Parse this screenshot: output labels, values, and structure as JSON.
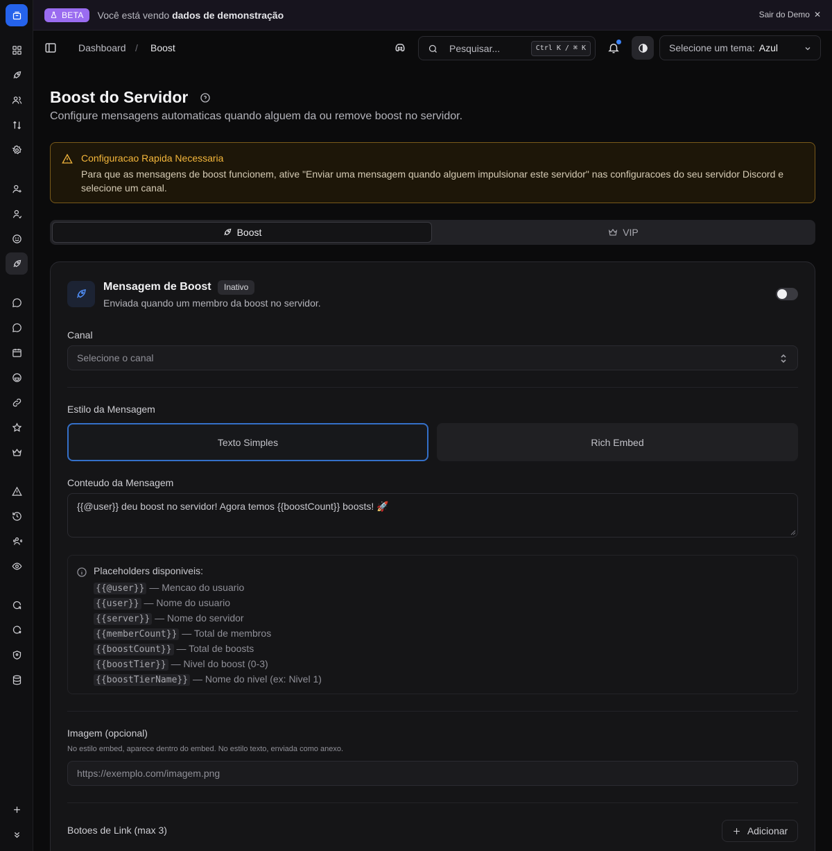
{
  "beta": {
    "badge": "BETA",
    "text_prefix": "Você está vendo ",
    "text_bold": "dados de demonstração",
    "exit": "Sair do Demo"
  },
  "breadcrumb": {
    "root": "Dashboard",
    "separator": "/",
    "current": "Boost"
  },
  "search": {
    "placeholder": "Pesquisar...",
    "shortcut": "Ctrl K / ⌘ K"
  },
  "theme": {
    "label": "Selecione um tema:",
    "value": "Azul"
  },
  "page": {
    "title": "Boost do Servidor",
    "subtitle": "Configure mensagens automaticas quando alguem da ou remove boost no servidor."
  },
  "warning": {
    "title": "Configuracao Rapida Necessaria",
    "body": "Para que as mensagens de boost funcionem, ative \"Enviar uma mensagem quando alguem impulsionar este servidor\" nas configuracoes do seu servidor Discord e selecione um canal."
  },
  "tabs": {
    "boost": "Boost",
    "vip": "VIP"
  },
  "card": {
    "title": "Mensagem de Boost",
    "status": "Inativo",
    "subtitle": "Enviada quando um membro da boost no servidor.",
    "enabled": false
  },
  "channel": {
    "label": "Canal",
    "placeholder": "Selecione o canal"
  },
  "style": {
    "label": "Estilo da Mensagem",
    "text": "Texto Simples",
    "embed": "Rich Embed",
    "selected": "Texto Simples"
  },
  "message": {
    "label": "Conteudo da Mensagem",
    "value": "{{@user}} deu boost no servidor! Agora temos {{boostCount}} boosts! 🚀"
  },
  "placeholders": {
    "title": "Placeholders disponiveis:",
    "items": [
      {
        "code": "{{@user}}",
        "desc": "— Mencao do usuario"
      },
      {
        "code": "{{user}}",
        "desc": "— Nome do usuario"
      },
      {
        "code": "{{server}}",
        "desc": "— Nome do servidor"
      },
      {
        "code": "{{memberCount}}",
        "desc": "— Total de membros"
      },
      {
        "code": "{{boostCount}}",
        "desc": "— Total de boosts"
      },
      {
        "code": "{{boostTier}}",
        "desc": "— Nivel do boost (0-3)"
      },
      {
        "code": "{{boostTierName}}",
        "desc": "— Nome do nivel (ex: Nivel 1)"
      }
    ]
  },
  "image": {
    "label": "Imagem (opcional)",
    "hint": "No estilo embed, aparece dentro do embed. No estilo texto, enviada como anexo.",
    "placeholder": "https://exemplo.com/imagem.png"
  },
  "buttons": {
    "label": "Botoes de Link (max 3)",
    "add": "Adicionar"
  },
  "colors": {
    "accent": "#2563eb",
    "warning": "#f5b73b",
    "beta": "#9a6cf0"
  }
}
